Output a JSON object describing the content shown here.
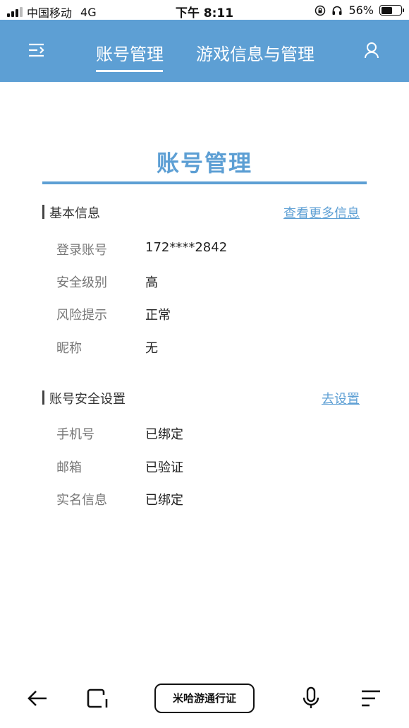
{
  "status_bar": {
    "carrier": "中国移动",
    "network": "4G",
    "time": "下午 8:11",
    "battery": "56%",
    "battery_level": 0.56
  },
  "header": {
    "tabs": [
      {
        "label": "账号管理",
        "active": true
      },
      {
        "label": "游戏信息与管理",
        "active": false
      }
    ],
    "menu_icon": "menu-icon",
    "user_icon": "user-icon"
  },
  "page": {
    "title": "账号管理"
  },
  "basic_info": {
    "title": "基本信息",
    "link": "查看更多信息",
    "rows": [
      {
        "label": "登录账号",
        "value": "172****2842"
      },
      {
        "label": "安全级别",
        "value": "高"
      },
      {
        "label": "风险提示",
        "value": "正常"
      },
      {
        "label": "昵称",
        "value": "无"
      }
    ]
  },
  "security": {
    "title": "账号安全设置",
    "link": "去设置",
    "rows": [
      {
        "label": "手机号",
        "value": "已绑定"
      },
      {
        "label": "邮箱",
        "value": "已验证"
      },
      {
        "label": "实名信息",
        "value": "已绑定"
      }
    ]
  },
  "bottom_bar": {
    "center_button": "米哈游通行证",
    "icons": [
      "back-arrow-icon",
      "tabs-icon",
      "microphone-icon",
      "menu-lines-icon"
    ]
  },
  "colors": {
    "accent": "#5d9fd4"
  }
}
